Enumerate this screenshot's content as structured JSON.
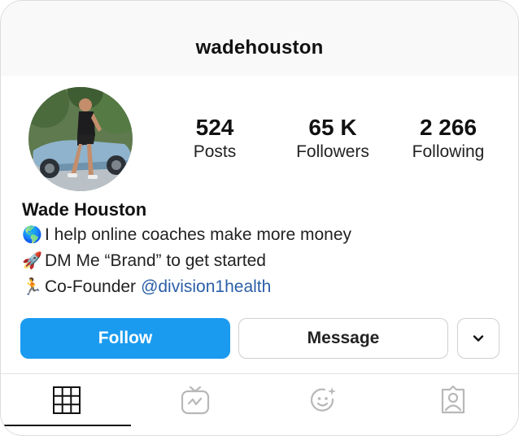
{
  "profile": {
    "username": "wadehouston",
    "stats": {
      "posts_value": "524",
      "posts_label": "Posts",
      "followers_value": "65 K",
      "followers_label": "Followers",
      "following_value": "2 266",
      "following_label": "Following"
    },
    "bio": {
      "name": "Wade Houston",
      "line1_emoji": "🌎",
      "line1_text": "I help online coaches make more money",
      "line2_emoji": "🚀",
      "line2_text": "DM Me “Brand” to get started",
      "line3_emoji": "🏃",
      "line3_text": "Co-Founder",
      "line3_link": "@division1health"
    }
  },
  "actions": {
    "follow_label": "Follow",
    "message_label": "Message",
    "more_icon": "chevron-down-icon"
  },
  "tabs": [
    {
      "icon": "grid-icon",
      "active": true
    },
    {
      "icon": "igtv-icon",
      "active": false
    },
    {
      "icon": "reels-sparkle-face-icon",
      "active": false
    },
    {
      "icon": "tagged-person-icon",
      "active": false
    }
  ],
  "colors": {
    "follow_button": "#1a9bf0",
    "link": "#2b5fa8",
    "tab_icon": "#b8b8b8",
    "active_tab_icon": "#111111"
  }
}
